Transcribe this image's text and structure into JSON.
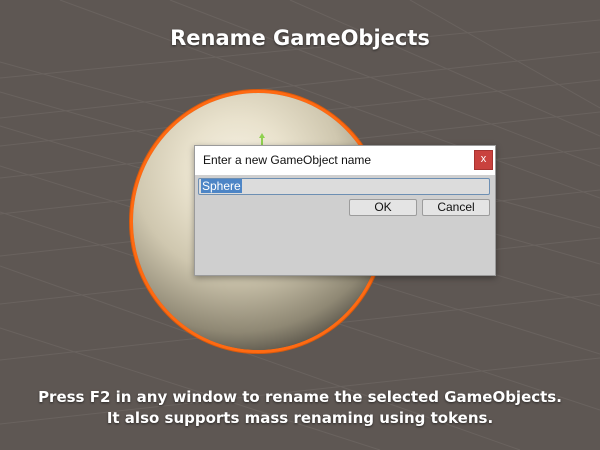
{
  "header": {
    "title": "Rename GameObjects"
  },
  "dialog": {
    "title": "Enter a new GameObject name",
    "close_label": "x",
    "input_value": "Sphere",
    "ok_label": "OK",
    "cancel_label": "Cancel"
  },
  "caption": {
    "line1": "Press F2 in any window to rename the selected GameObjects.",
    "line2": "It also supports mass renaming using tokens."
  },
  "colors": {
    "scene_background": "#5e5753",
    "selection_outline": "#ff6a12",
    "close_button": "#c9423e",
    "text_selection": "#4d85c6"
  },
  "icons": {
    "gizmo": "green-axis-gizmo-icon",
    "close": "close-icon"
  }
}
